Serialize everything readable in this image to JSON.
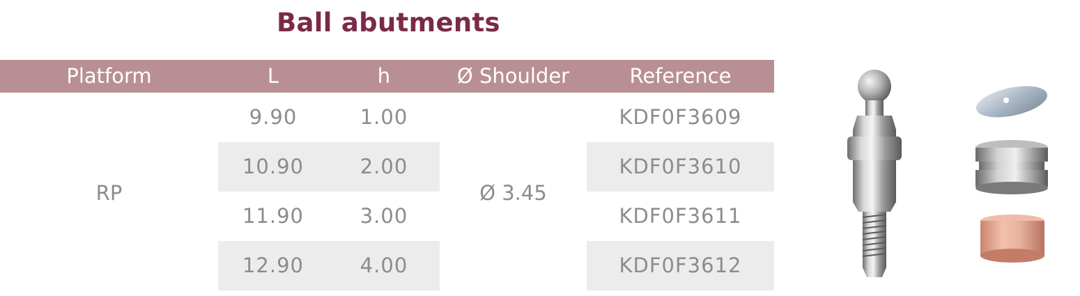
{
  "title": "Ball abutments",
  "table": {
    "headers": [
      "Platform",
      "L",
      "h",
      "Ø Shoulder",
      "Reference"
    ],
    "platform": "RP",
    "shoulder": "Ø 3.45",
    "rows": [
      {
        "L": "9.90",
        "h": "1.00",
        "reference": "KDF0F3609"
      },
      {
        "L": "10.90",
        "h": "2.00",
        "reference": "KDF0F3610"
      },
      {
        "L": "11.90",
        "h": "3.00",
        "reference": "KDF0F3611"
      },
      {
        "L": "12.90",
        "h": "4.00",
        "reference": "KDF0F3612"
      }
    ]
  },
  "colors": {
    "title": "#7a2a48",
    "header_bg": "#b98f96",
    "row_shade": "#ececec",
    "cell_text": "#8c8c8c"
  }
}
